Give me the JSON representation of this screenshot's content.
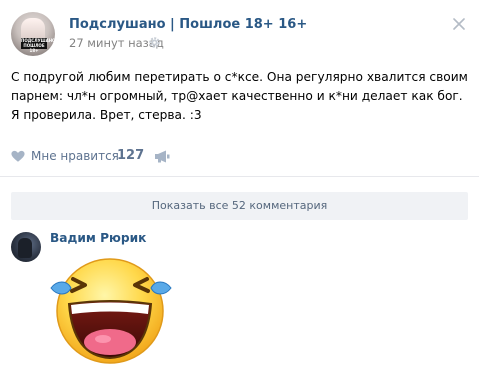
{
  "header": {
    "title": "Подслушано | Пошлое 18+ 16+",
    "time": "27 минут назад",
    "avatar_text": "ПОДСЛУШАНО ПОШЛОЕ 18+"
  },
  "post": {
    "text": "С подругой любим перетирать о с*ксе. Она регулярно хвалится своим парнем: чл*н огромный, тр@хает качественно и к*ни делает как бог. Я проверила. Врет, стерва. :3"
  },
  "likes": {
    "label": "Мне нравится",
    "count": "127"
  },
  "comments": {
    "show_all_label": "Показать все 52 комментария"
  },
  "comment": {
    "author": "Вадим Рюрик"
  },
  "colors": {
    "link": "#2a5885",
    "meta": "#828282",
    "action": "#5e7390",
    "button_bg": "#f0f2f5"
  },
  "icons": {
    "settings": "gear-icon",
    "close": "close-icon",
    "like": "heart-icon",
    "share": "megaphone-icon",
    "sticker": "laughing-crying-emoji"
  }
}
